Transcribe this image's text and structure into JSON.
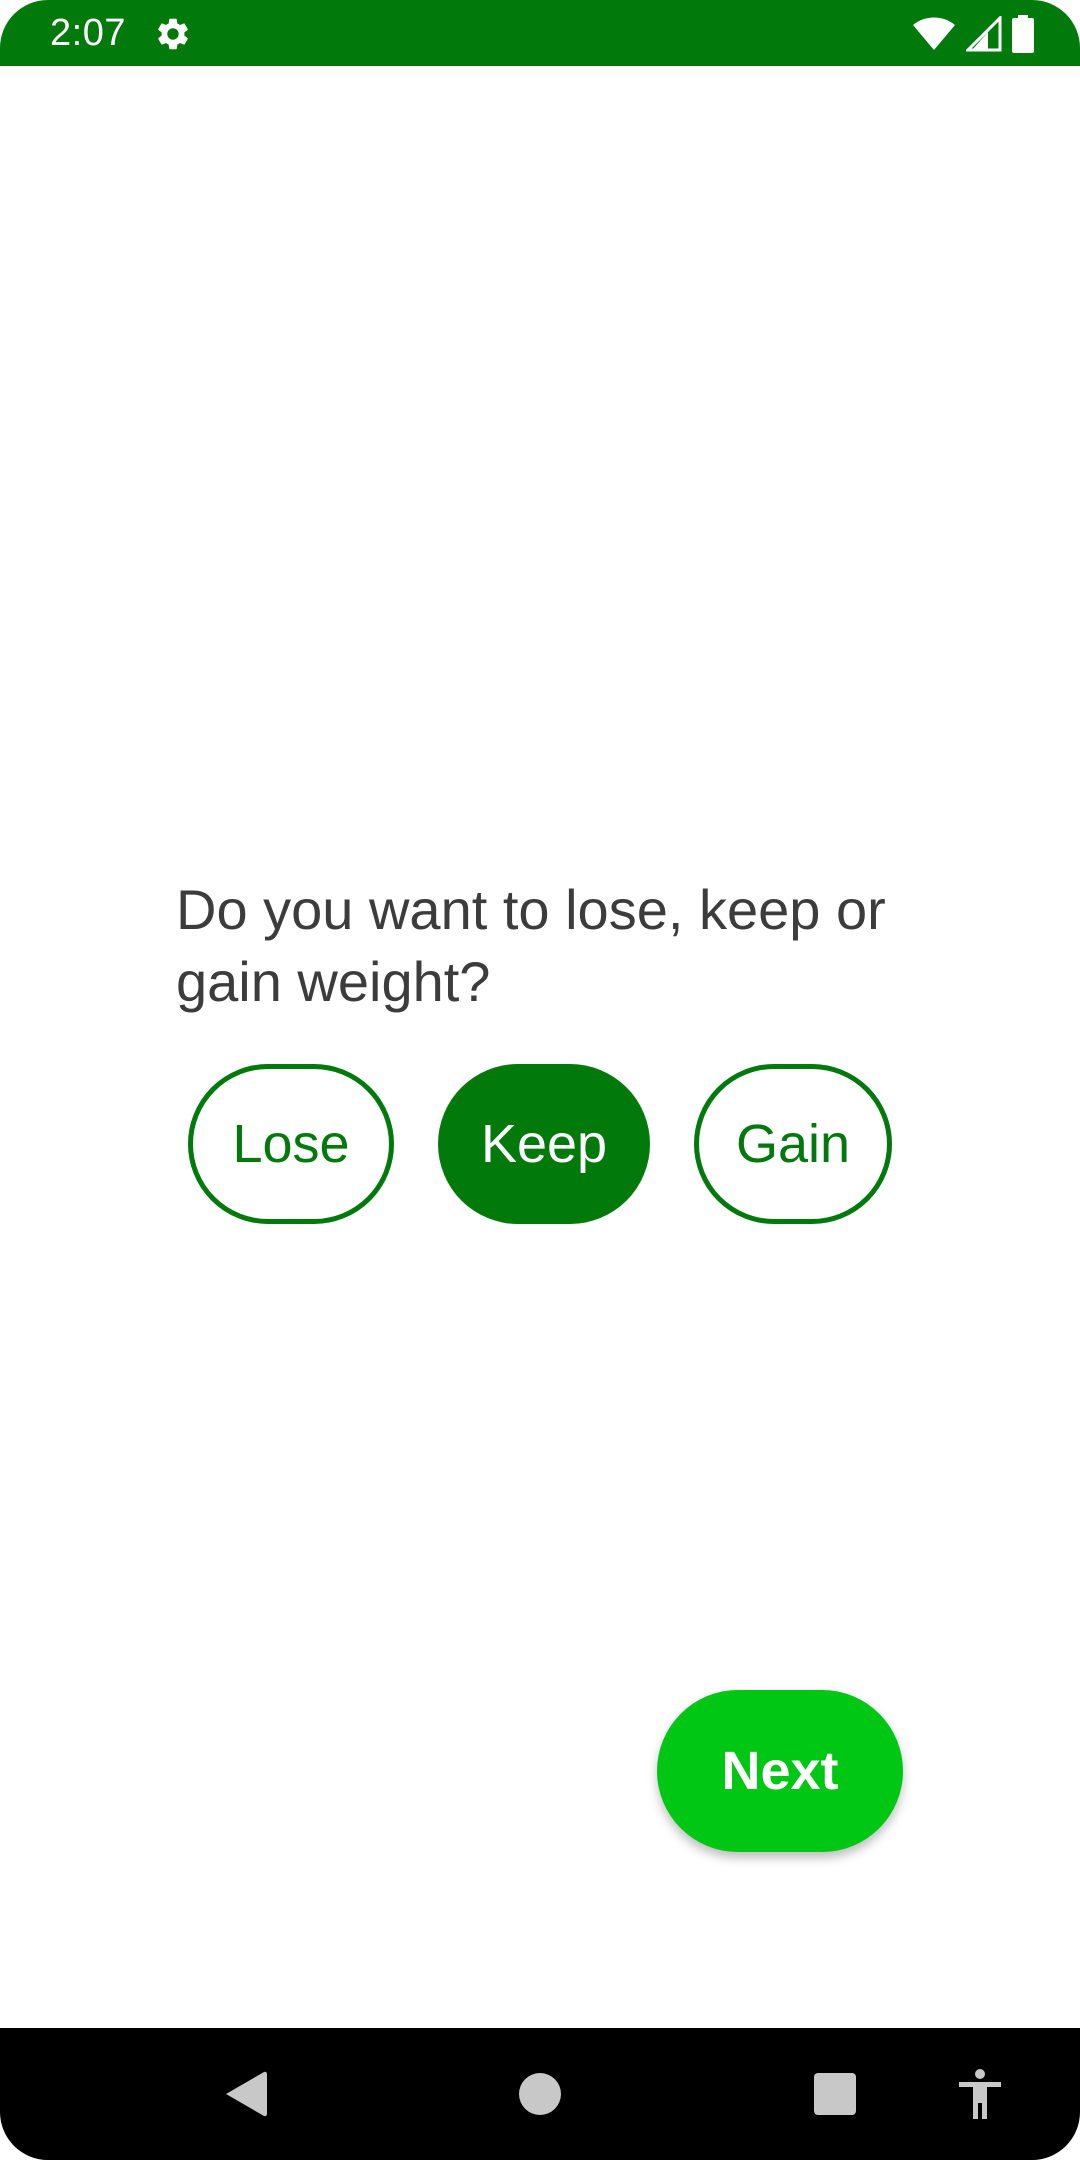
{
  "status_bar": {
    "time": "2:07",
    "icons": [
      "settings-gear-icon",
      "wifi-icon",
      "cell-signal-icon",
      "battery-icon"
    ],
    "background_color": "#027a0b"
  },
  "question": {
    "text": "Do you want to lose, keep or gain weight?"
  },
  "choices": [
    {
      "label": "Lose",
      "selected": false
    },
    {
      "label": "Keep",
      "selected": true
    },
    {
      "label": "Gain",
      "selected": false
    }
  ],
  "next_button": {
    "label": "Next",
    "color": "#00c614"
  },
  "accent_color": "#027a0b",
  "nav_bar": {
    "icons": [
      "back-icon",
      "home-icon",
      "recents-icon",
      "accessibility-icon"
    ]
  }
}
